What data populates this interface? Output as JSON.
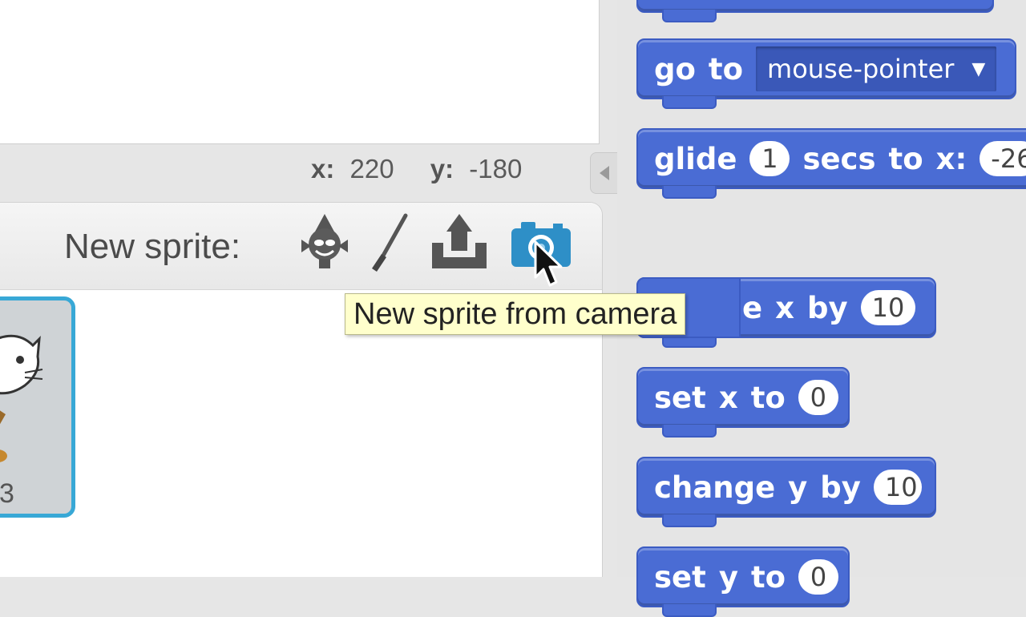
{
  "stage": {
    "x_label": "x:",
    "x_value": "220",
    "y_label": "y:",
    "y_value": "-180"
  },
  "sprites": {
    "new_sprite_label": "New sprite:",
    "tools": [
      {
        "icon": "sprite-library-icon"
      },
      {
        "icon": "paint-brush-icon"
      },
      {
        "icon": "upload-icon"
      },
      {
        "icon": "camera-icon"
      }
    ],
    "tooltip": "New sprite from camera",
    "thumbnail": {
      "name_fragment": "3"
    }
  },
  "palette": {
    "blocks": [
      {
        "text": [
          "go",
          "to"
        ],
        "dropdown": "mouse-pointer"
      },
      {
        "text": [
          "glide"
        ],
        "input": "1",
        "text2": [
          "secs",
          "to",
          "x:"
        ],
        "input2": "-26"
      },
      {
        "text": [
          "e",
          "x",
          "by"
        ],
        "input": "10"
      },
      {
        "text": [
          "set",
          "x",
          "to"
        ],
        "input": "0"
      },
      {
        "text": [
          "change",
          "y",
          "by"
        ],
        "input": "10"
      },
      {
        "text": [
          "set",
          "y",
          "to"
        ],
        "input": "0"
      }
    ]
  },
  "colors": {
    "motion_block": "#4a6cd4",
    "selection_border": "#38a8d6",
    "tooltip_bg": "#ffffcc",
    "camera_icon": "#2e8fc7"
  }
}
